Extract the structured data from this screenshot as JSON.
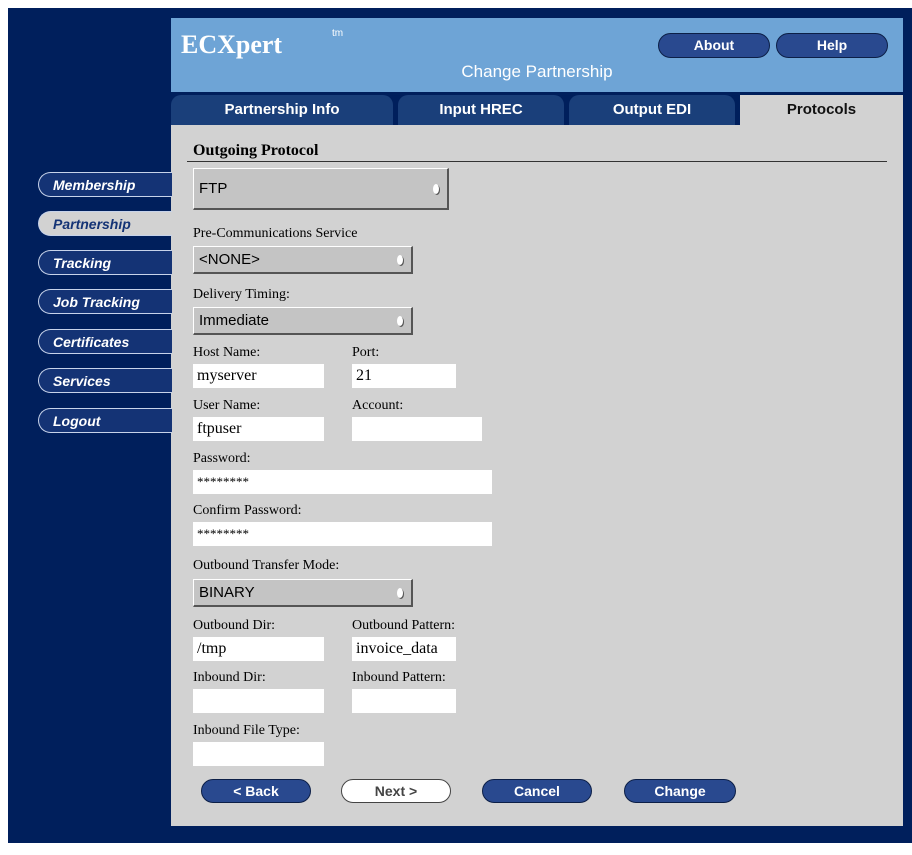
{
  "header": {
    "logo": "ECXpert",
    "trademark": "tm",
    "subtitle": "Change Partnership",
    "about": "About",
    "help": "Help"
  },
  "tabs": [
    {
      "label": "Partnership Info"
    },
    {
      "label": "Input HREC"
    },
    {
      "label": "Output EDI"
    },
    {
      "label": "Protocols"
    }
  ],
  "nav": [
    {
      "label": "Membership"
    },
    {
      "label": "Partnership"
    },
    {
      "label": "Tracking"
    },
    {
      "label": "Job Tracking"
    },
    {
      "label": "Certificates"
    },
    {
      "label": "Services"
    },
    {
      "label": "Logout"
    }
  ],
  "form": {
    "heading": "Outgoing Protocol",
    "protocol": "FTP",
    "pre_comm_label": "Pre-Communications Service",
    "pre_comm_value": "<NONE>",
    "delivery_label": "Delivery Timing:",
    "delivery_value": "Immediate",
    "host_label": "Host Name:",
    "host_value": "myserver",
    "port_label": "Port:",
    "port_value": "21",
    "user_label": "User Name:",
    "user_value": "ftpuser",
    "account_label": "Account:",
    "account_value": "",
    "password_label": "Password:",
    "password_value": "********",
    "confirm_label": "Confirm Password:",
    "confirm_value": "********",
    "transfer_label": "Outbound Transfer Mode:",
    "transfer_value": "BINARY",
    "out_dir_label": "Outbound Dir:",
    "out_dir_value": "/tmp",
    "out_pattern_label": "Outbound Pattern:",
    "out_pattern_value": "invoice_data",
    "in_dir_label": "Inbound Dir:",
    "in_dir_value": "",
    "in_pattern_label": "Inbound Pattern:",
    "in_pattern_value": "",
    "in_type_label": "Inbound File Type:",
    "in_type_value": ""
  },
  "buttons": {
    "back": "< Back",
    "next": "Next >",
    "cancel": "Cancel",
    "change": "Change"
  }
}
